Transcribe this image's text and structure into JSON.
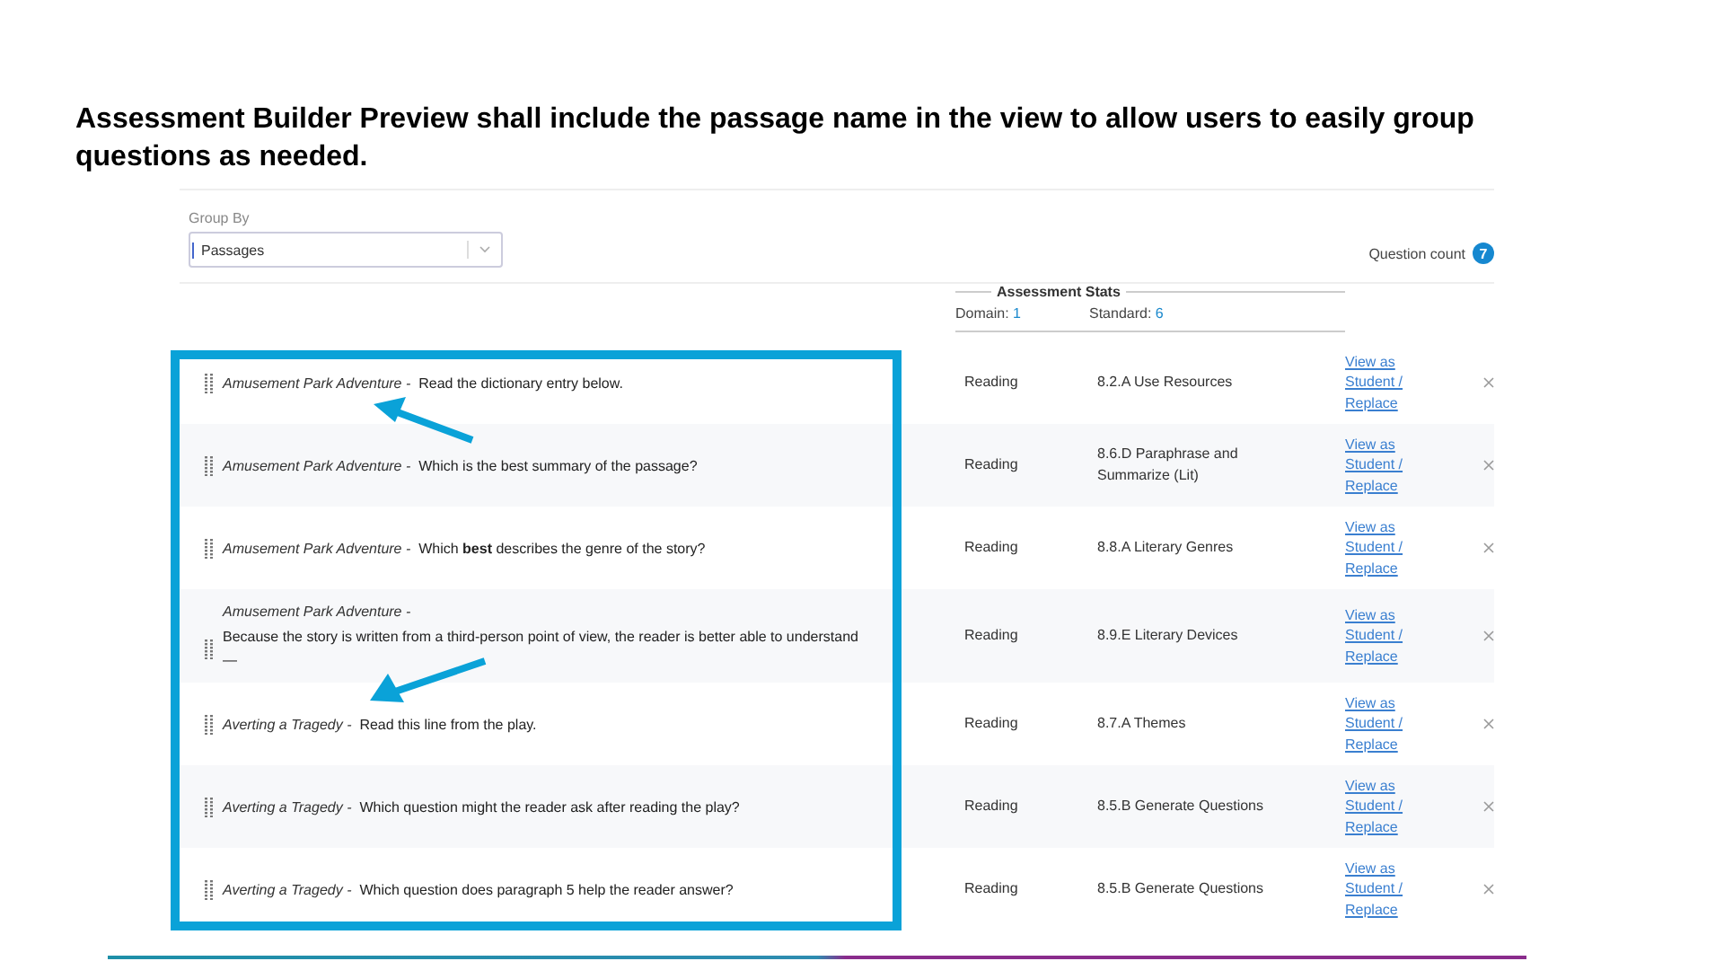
{
  "slide_title": "Assessment Builder Preview shall include the passage name in the view to allow users to easily group questions as needed.",
  "group_by": {
    "label": "Group By",
    "value": "Passages"
  },
  "question_count": {
    "label": "Question count",
    "value": "7"
  },
  "stats": {
    "title": "Assessment Stats",
    "domain_label": "Domain:",
    "domain_value": "1",
    "standard_label": "Standard:",
    "standard_value": "6"
  },
  "rows": [
    {
      "kind": "inline",
      "passage": "Amusement Park Adventure -",
      "question": "Read the dictionary entry below.",
      "domain": "Reading",
      "standard": "8.2.A Use Resources",
      "action": "View as Student / Replace"
    },
    {
      "kind": "inline",
      "passage": "Amusement Park Adventure -",
      "question": "Which is the best summary of the passage?",
      "domain": "Reading",
      "standard": "8.6.D Paraphrase and Summarize (Lit)",
      "action": "View as Student / Replace"
    },
    {
      "kind": "inline",
      "passage": "Amusement Park Adventure -",
      "question": "Which **best** describes the genre of the story?",
      "domain": "Reading",
      "standard": "8.8.A Literary Genres",
      "action": "View as Student / Replace"
    },
    {
      "kind": "stacked",
      "passage": "Amusement Park Adventure -",
      "question": "Because the story is written from a third-person point of view, the reader is better able to understand —",
      "domain": "Reading",
      "standard": "8.9.E Literary Devices",
      "action": "View as Student / Replace"
    },
    {
      "kind": "inline",
      "passage": "Averting a Tragedy -",
      "question": "Read this line from the play.",
      "domain": "Reading",
      "standard": "8.7.A Themes",
      "action": "View as Student / Replace"
    },
    {
      "kind": "inline",
      "passage": "Averting a Tragedy -",
      "question": "Which question might the reader ask after reading the play?",
      "domain": "Reading",
      "standard": "8.5.B Generate Questions",
      "action": "View as Student / Replace"
    },
    {
      "kind": "inline",
      "passage": "Averting a Tragedy -",
      "question": "Which question does paragraph 5 help the reader answer?",
      "domain": "Reading",
      "standard": "8.5.B Generate Questions",
      "action": "View as Student / Replace"
    }
  ]
}
